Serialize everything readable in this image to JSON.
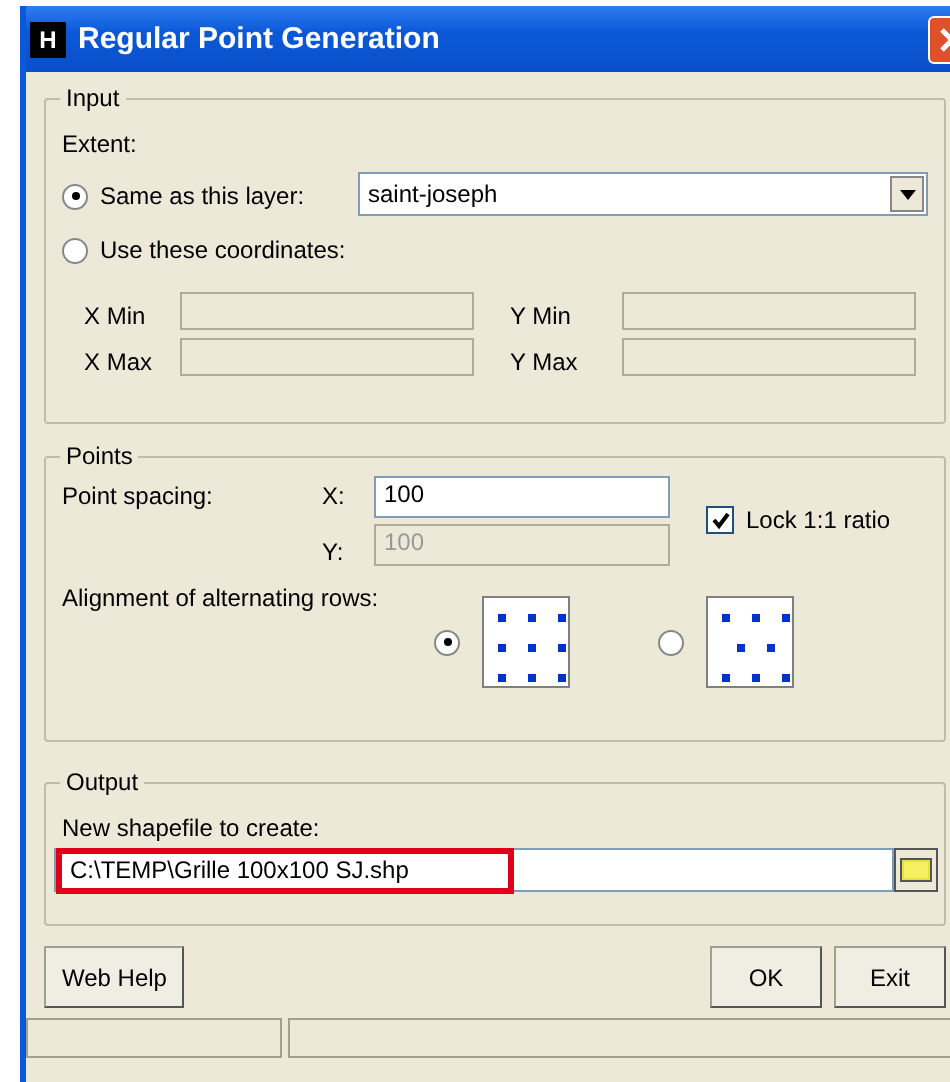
{
  "window": {
    "icon_letter": "H",
    "title": "Regular Point Generation"
  },
  "input": {
    "legend": "Input",
    "extent_label": "Extent:",
    "options": [
      {
        "label": "Same as this layer:",
        "selected": true
      },
      {
        "label": "Use these coordinates:",
        "selected": false
      }
    ],
    "layer": "saint-joseph",
    "coords": [
      {
        "label": "X Min"
      },
      {
        "label": "Y Min"
      },
      {
        "label": "X Max"
      },
      {
        "label": "Y Max"
      }
    ]
  },
  "points": {
    "legend": "Points",
    "spacing_label": "Point spacing:",
    "x_label": "X:",
    "x_value": "100",
    "y_label": "Y:",
    "y_value": "100",
    "y_disabled": true,
    "lock": {
      "label": "Lock 1:1 ratio",
      "checked": true
    },
    "alignment_label": "Alignment of alternating rows:",
    "alignments": [
      {
        "kind": "grid",
        "selected": true
      },
      {
        "kind": "staggered",
        "selected": false
      }
    ]
  },
  "output": {
    "legend": "Output",
    "label": "New shapefile to create:",
    "value": "C:\\TEMP\\Grille 100x100 SJ.shp",
    "highlighted": true
  },
  "buttons": {
    "help": "Web Help",
    "ok": "OK",
    "exit": "Exit"
  }
}
